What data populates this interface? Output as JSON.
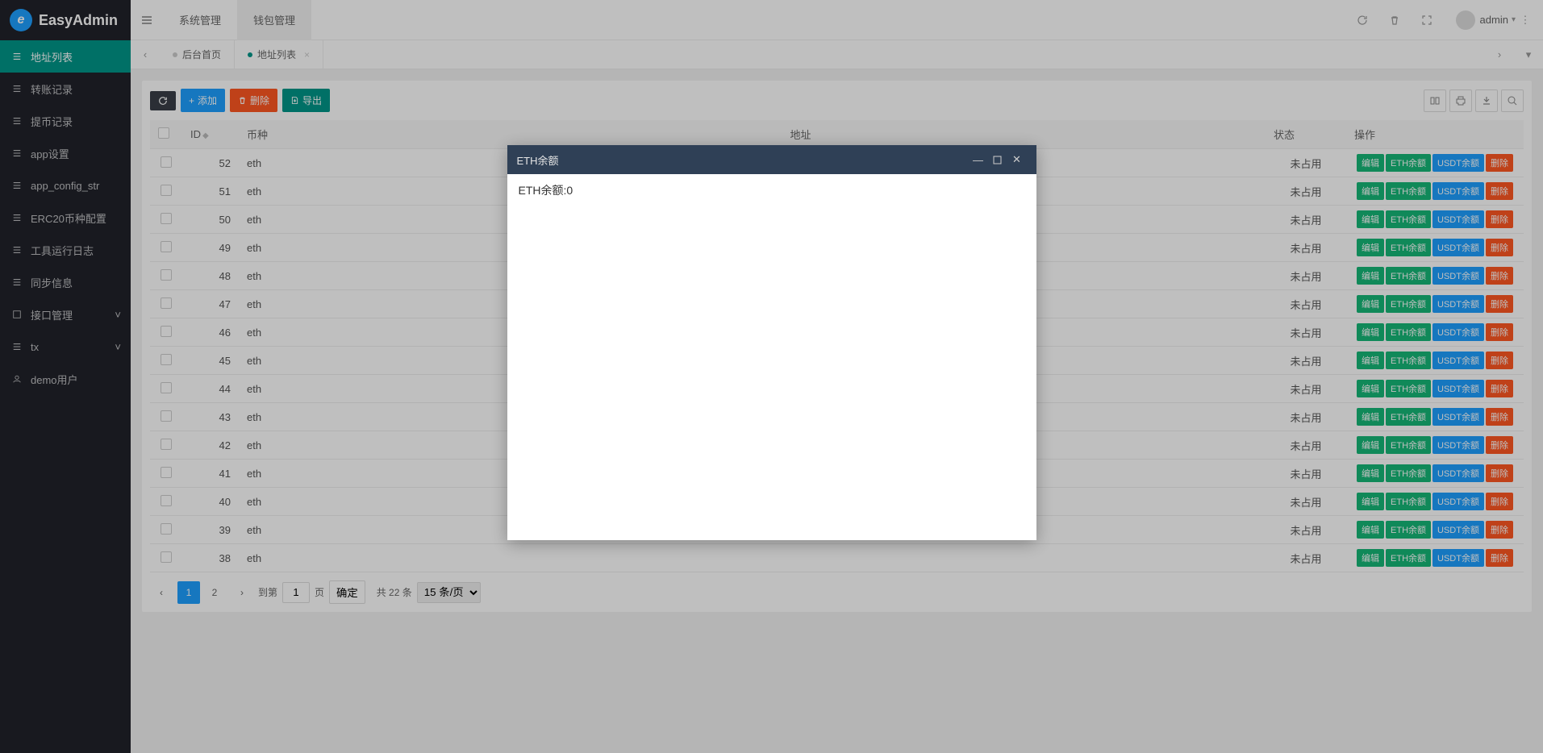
{
  "brand": "EasyAdmin",
  "topTabs": {
    "sys": "系统管理",
    "wallet": "钱包管理"
  },
  "user": {
    "name": "admin"
  },
  "sidebar": {
    "items": [
      {
        "label": "地址列表",
        "icon": "list",
        "active": true
      },
      {
        "label": "转账记录",
        "icon": "list"
      },
      {
        "label": "提币记录",
        "icon": "list"
      },
      {
        "label": "app设置",
        "icon": "list"
      },
      {
        "label": "app_config_str",
        "icon": "list"
      },
      {
        "label": "ERC20币种配置",
        "icon": "list"
      },
      {
        "label": "工具运行日志",
        "icon": "list"
      },
      {
        "label": "同步信息",
        "icon": "list"
      },
      {
        "label": "接口管理",
        "icon": "box",
        "caret": true
      },
      {
        "label": "tx",
        "icon": "list",
        "caret": true
      },
      {
        "label": "demo用户",
        "icon": "user"
      }
    ]
  },
  "breadcrumbTabs": [
    {
      "label": "后台首页",
      "active": false,
      "closable": false
    },
    {
      "label": "地址列表",
      "active": true,
      "closable": true
    }
  ],
  "toolbar": {
    "refresh": "",
    "add": "添加",
    "delete": "删除",
    "export": "导出"
  },
  "table": {
    "headers": {
      "id": "ID",
      "coin": "币种",
      "address": "地址",
      "status": "状态",
      "ops": "操作"
    },
    "opLabels": {
      "edit": "编辑",
      "eth": "ETH余额",
      "usdt": "USDT余额",
      "del": "删除"
    },
    "rows": [
      {
        "id": "52",
        "coin": "eth",
        "status": "未占用"
      },
      {
        "id": "51",
        "coin": "eth",
        "status": "未占用"
      },
      {
        "id": "50",
        "coin": "eth",
        "status": "未占用"
      },
      {
        "id": "49",
        "coin": "eth",
        "status": "未占用"
      },
      {
        "id": "48",
        "coin": "eth",
        "status": "未占用"
      },
      {
        "id": "47",
        "coin": "eth",
        "status": "未占用"
      },
      {
        "id": "46",
        "coin": "eth",
        "status": "未占用"
      },
      {
        "id": "45",
        "coin": "eth",
        "status": "未占用"
      },
      {
        "id": "44",
        "coin": "eth",
        "status": "未占用"
      },
      {
        "id": "43",
        "coin": "eth",
        "status": "未占用"
      },
      {
        "id": "42",
        "coin": "eth",
        "status": "未占用"
      },
      {
        "id": "41",
        "coin": "eth",
        "status": "未占用"
      },
      {
        "id": "40",
        "coin": "eth",
        "status": "未占用"
      },
      {
        "id": "39",
        "coin": "eth",
        "status": "未占用"
      },
      {
        "id": "38",
        "coin": "eth",
        "status": "未占用"
      }
    ]
  },
  "pager": {
    "pages": [
      "1",
      "2"
    ],
    "current": "1",
    "gotoLabel": "到第",
    "gotoValue": "1",
    "gotoSuffix": "页",
    "confirm": "确定",
    "totalLabel": "共 22 条",
    "perPage": "15 条/页"
  },
  "modal": {
    "title": "ETH余额",
    "body": "ETH余额:0"
  }
}
